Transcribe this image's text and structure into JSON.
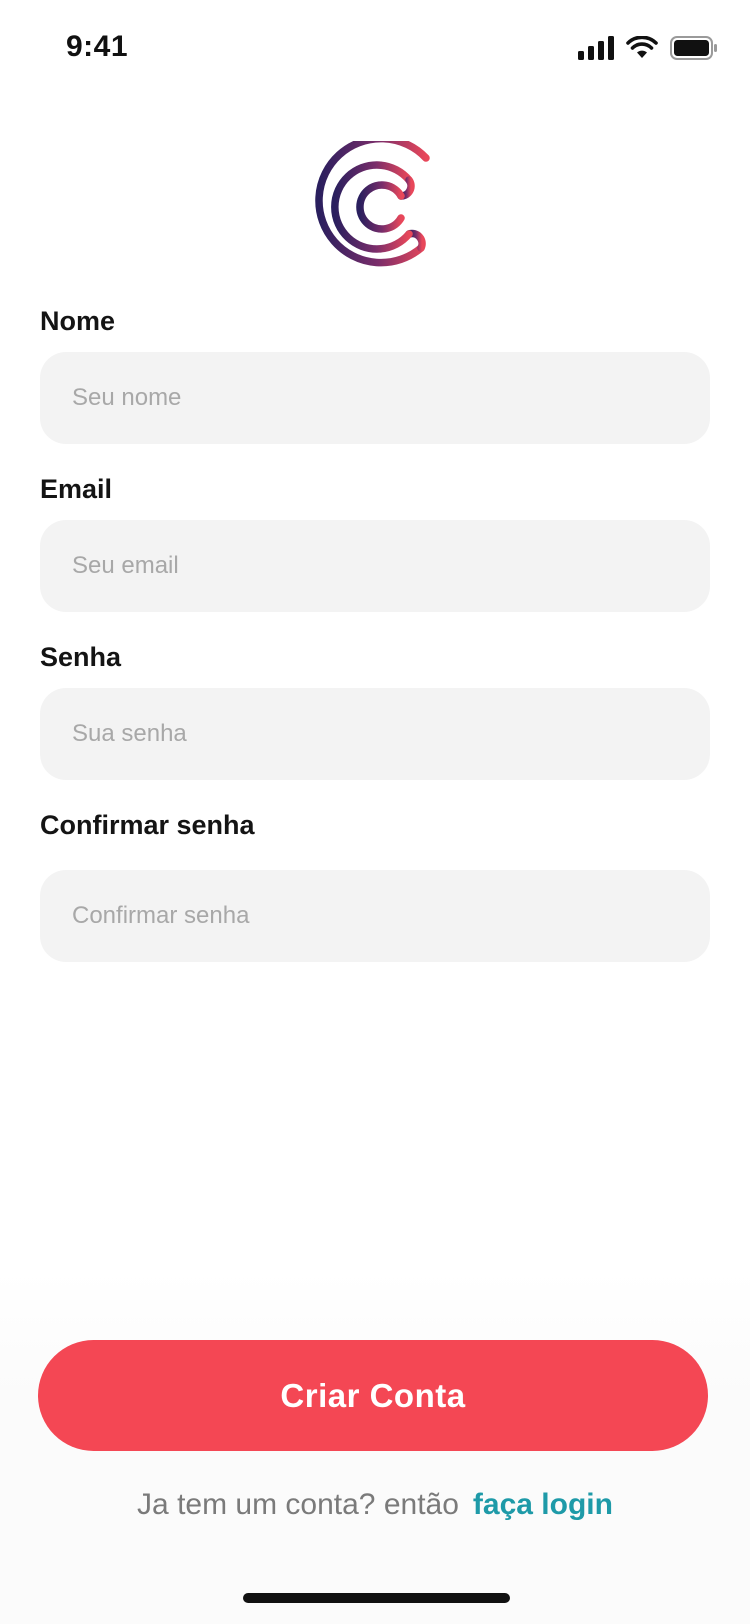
{
  "status_bar": {
    "time": "9:41",
    "icons": [
      "signal-icon",
      "wifi-icon",
      "battery-icon"
    ]
  },
  "logo": {
    "icon": "brand-logo",
    "colors": {
      "gradient_start": "#2a1f5e",
      "gradient_end": "#e8475a"
    }
  },
  "form": {
    "name": {
      "label": "Nome",
      "placeholder": "Seu nome",
      "value": ""
    },
    "email": {
      "label": "Email",
      "placeholder": "Seu email",
      "value": ""
    },
    "password": {
      "label": "Senha",
      "placeholder": "Sua senha",
      "value": ""
    },
    "confirm_password": {
      "label": "Confirmar senha",
      "placeholder": "Confirmar senha",
      "value": ""
    }
  },
  "actions": {
    "create_account_label": "Criar Conta",
    "login_prompt": "Ja tem um conta? então",
    "login_link": "faça login"
  },
  "colors": {
    "primary_button": "#f44754",
    "link": "#1e9aa8",
    "input_background": "#f3f3f3",
    "placeholder": "#a8a8a8"
  }
}
